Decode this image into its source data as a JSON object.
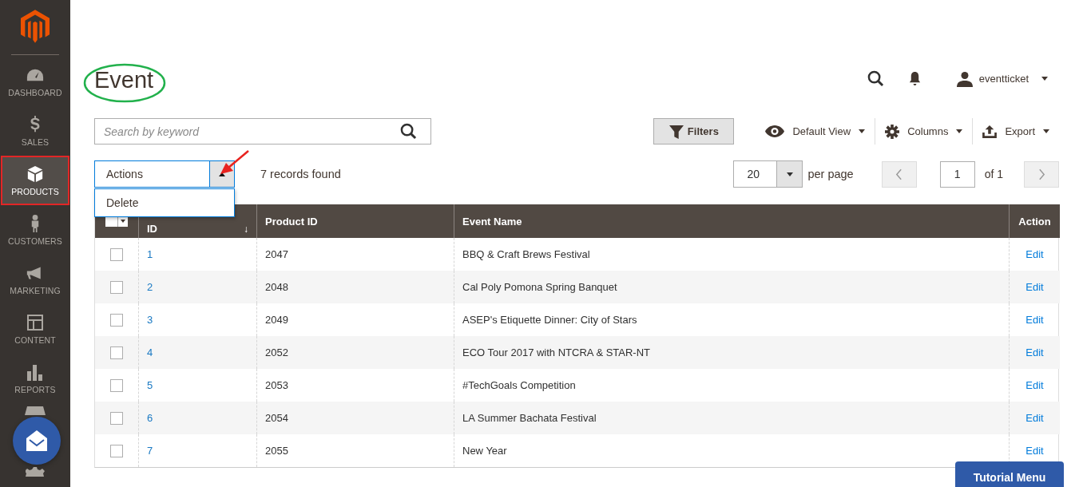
{
  "sidebar": {
    "items": [
      {
        "kind": "dashboard",
        "label": "DASHBOARD",
        "selected": false
      },
      {
        "kind": "sales",
        "label": "SALES",
        "selected": false
      },
      {
        "kind": "products",
        "label": "PRODUCTS",
        "selected": true
      },
      {
        "kind": "customers",
        "label": "CUSTOMERS",
        "selected": false
      },
      {
        "kind": "marketing",
        "label": "MARKETING",
        "selected": false
      },
      {
        "kind": "content",
        "label": "CONTENT",
        "selected": false
      },
      {
        "kind": "reports",
        "label": "REPORTS",
        "selected": false
      },
      {
        "kind": "stores",
        "selected": false
      },
      {
        "kind": "system",
        "selected": false
      }
    ]
  },
  "page_title": "Event",
  "user": {
    "name": "eventticket"
  },
  "search": {
    "placeholder": "Search by keyword"
  },
  "toolbar": {
    "filters": "Filters",
    "view": "Default View",
    "columns": "Columns",
    "export": "Export"
  },
  "actions": {
    "label": "Actions",
    "expanded": true,
    "options": [
      "Delete"
    ]
  },
  "records_found": "7 records found",
  "pager": {
    "per_page": "20",
    "per_page_label": "per page",
    "page": "1",
    "of": "of 1"
  },
  "mass_select": {
    "checked": false
  },
  "table": {
    "columns": [
      "ID",
      "Product ID",
      "Event Name",
      "Action"
    ],
    "sort_mark": "↓",
    "rows": [
      {
        "checked": false,
        "id": "1",
        "product_id": "2047",
        "event_name": "BBQ & Craft Brews Festival",
        "action": "Edit"
      },
      {
        "checked": false,
        "id": "2",
        "product_id": "2048",
        "event_name": "Cal Poly Pomona Spring Banquet",
        "action": "Edit"
      },
      {
        "checked": false,
        "id": "3",
        "product_id": "2049",
        "event_name": "ASEP's Etiquette Dinner: City of Stars",
        "action": "Edit"
      },
      {
        "checked": false,
        "id": "4",
        "product_id": "2052",
        "event_name": "ECO Tour 2017 with NTCRA & STAR-NT",
        "action": "Edit"
      },
      {
        "checked": false,
        "id": "5",
        "product_id": "2053",
        "event_name": "#TechGoals Competition",
        "action": "Edit"
      },
      {
        "checked": false,
        "id": "6",
        "product_id": "2054",
        "event_name": "LA Summer Bachata Festival",
        "action": "Edit"
      },
      {
        "checked": false,
        "id": "7",
        "product_id": "2055",
        "event_name": "New Year",
        "action": "Edit"
      }
    ]
  },
  "tutorial_button": "Tutorial Menu"
}
